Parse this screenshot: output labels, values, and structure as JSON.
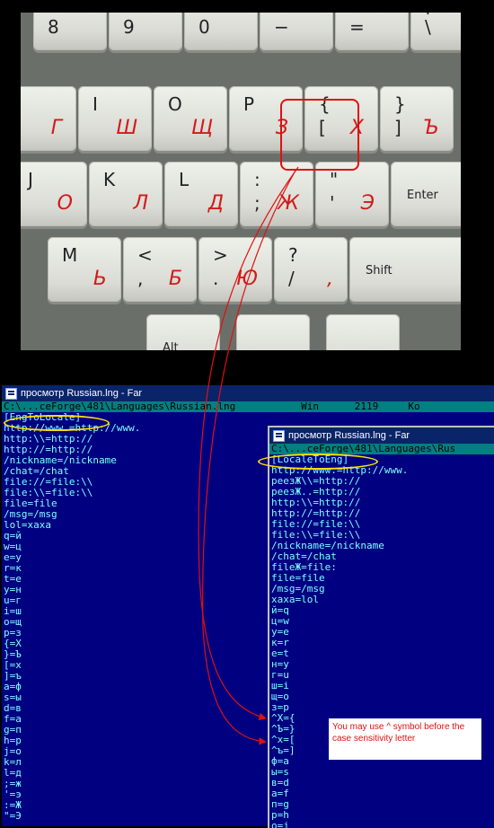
{
  "keyboard": {
    "row1": [
      {
        "top": "*",
        "bottom": "8",
        "ru": ""
      },
      {
        "top": "(",
        "bottom": "9",
        "ru": ""
      },
      {
        "top": ")",
        "bottom": "0",
        "ru": ""
      },
      {
        "top": "—",
        "bottom": "−",
        "ru": ""
      },
      {
        "top": "+",
        "bottom": "=",
        "ru": ""
      },
      {
        "top": "|",
        "bottom": "\\",
        "ru": "/"
      }
    ],
    "row2": [
      {
        "top": "",
        "bottom": "",
        "ru": "Г"
      },
      {
        "top": "I",
        "bottom": "",
        "ru": "Ш"
      },
      {
        "top": "O",
        "bottom": "",
        "ru": "Щ"
      },
      {
        "top": "P",
        "bottom": "",
        "ru": "З"
      },
      {
        "top": "{",
        "bottom": "[",
        "ru": "Х"
      },
      {
        "top": "}",
        "bottom": "]",
        "ru": "Ъ"
      }
    ],
    "row3": [
      {
        "top": "J",
        "bottom": "",
        "ru": "О"
      },
      {
        "top": "K",
        "bottom": "",
        "ru": "Л"
      },
      {
        "top": "L",
        "bottom": "",
        "ru": "Д"
      },
      {
        "top": ":",
        "bottom": ";",
        "ru": "Ж"
      },
      {
        "top": "\"",
        "bottom": "'",
        "ru": "Э"
      },
      {
        "top": "",
        "bottom": "",
        "ru": "",
        "word": "Enter"
      }
    ],
    "row4": [
      {
        "top": "M",
        "bottom": "",
        "ru": "Ь"
      },
      {
        "top": "<",
        "bottom": ",",
        "ru": "Б"
      },
      {
        "top": ">",
        "bottom": ".",
        "ru": "Ю"
      },
      {
        "top": "?",
        "bottom": "/",
        "ru": ","
      },
      {
        "top": "",
        "bottom": "",
        "ru": "",
        "word": "Shift"
      }
    ],
    "row5": [
      {
        "word": "Alt"
      },
      {
        "word": ""
      },
      {
        "word": ""
      }
    ]
  },
  "window1": {
    "title": "просмотр Russian.lng - Far",
    "path": "C:\\...ceForge\\481\\Languages\\Russian.lng           Win      2119     Ko",
    "lines": [
      "[EngToLocale]",
      "http://www.=http://www.",
      "http:\\\\=http://",
      "http://=http://",
      "/nickname=/nickname",
      "/chat=/chat",
      "file://=file:\\\\",
      "file:\\\\=file:\\\\",
      "file=file",
      "/msg=/msg",
      "lol=хаха",
      "q=й",
      "w=ц",
      "e=у",
      "r=к",
      "t=е",
      "y=н",
      "u=г",
      "i=ш",
      "o=щ",
      "p=з",
      "{=Х",
      "}=Ъ",
      "[=х",
      "]=ъ",
      "a=ф",
      "s=ы",
      "d=в",
      "f=а",
      "g=п",
      "h=р",
      "j=о",
      "k=л",
      "l=д",
      ";=ж",
      "'=э",
      ":=Ж",
      "\"=Э"
    ]
  },
  "window2": {
    "title": "просмотр Russian.lng - Far",
    "path": "C:\\...ceForge\\481\\Languages\\Rus",
    "lines": [
      "[LocaleToEng]",
      "http://www.=http://www.",
      "реезЖ\\\\=http://",
      "реезЖ..=http://",
      "http:\\\\=http://",
      "http://=http://",
      "file://=file:\\\\",
      "file:\\\\=file:\\\\",
      "/nickname=/nickname",
      "/chat=/chat",
      "fileЖ=file:",
      "file=file",
      "/msg=/msg",
      "хаха=lol",
      "й=q",
      "ц=w",
      "у=e",
      "к=r",
      "е=t",
      "н=y",
      "г=u",
      "ш=i",
      "щ=o",
      "з=p",
      "^Х={",
      "^Ъ=}",
      "^х=[",
      "^ъ=]",
      "ф=a",
      "ы=s",
      "в=d",
      "а=f",
      "п=g",
      "р=h",
      "о=j"
    ]
  },
  "note": "You may use ^ symbol before the case sensitivity letter",
  "colors": {
    "arrow": "#e01010",
    "ellipse": "#ffe000",
    "editor_bg": "#000080",
    "editor_text": "#7fffff"
  }
}
